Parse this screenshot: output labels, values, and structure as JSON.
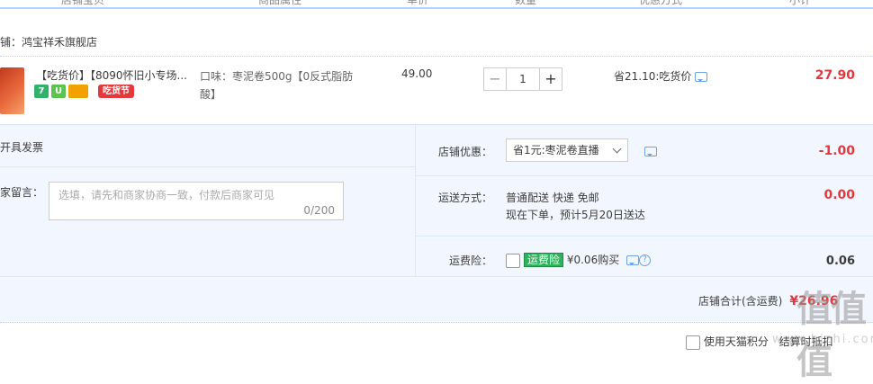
{
  "columns": [
    "店铺宝贝",
    "商品属性",
    "单价",
    "数量",
    "优惠方式",
    "小计"
  ],
  "shop_label": "铺：鸿宝祥禾旗舰店",
  "item": {
    "title": "【吃货价】【8090怀旧小专场...",
    "badges": [
      "7",
      "U",
      ""
    ],
    "festival_tag": "吃货节",
    "attr": "口味：枣泥卷500g【0反式脂肪酸】",
    "price": "49.00",
    "quantity": "1",
    "minus": "−",
    "plus": "+",
    "discount": "省21.10:吃货价",
    "subtotal": "27.90"
  },
  "invoice_label": "开具发票",
  "message": {
    "label": "卖家留言：",
    "placeholder": "选填，请先和商家协商一致，付款后商家可见",
    "count": "0/200"
  },
  "shop_discount": {
    "label": "店铺优惠：",
    "selected": "省1元:枣泥卷直播",
    "amount": "-1.00"
  },
  "shipping": {
    "label": "运送方式：",
    "method": "普通配送 快递 免邮",
    "eta": "现在下单，预计5月20日送达",
    "amount": "0.00"
  },
  "insurance": {
    "label": "运费险：",
    "badge": "运费险",
    "text": "¥0.06购买",
    "amount": "0.06"
  },
  "total": {
    "label": "店铺合计(含运费)",
    "amount": "¥26.96"
  },
  "footer": {
    "option": "使用天猫积分",
    "right": "结算时抵扣"
  },
  "watermark": "值",
  "watermark_url": "www.hizhi.com"
}
